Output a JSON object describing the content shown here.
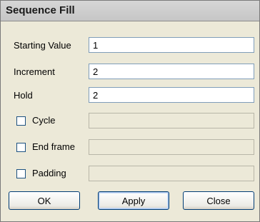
{
  "dialog": {
    "title": "Sequence Fill"
  },
  "fields": {
    "starting_value": {
      "label": "Starting Value",
      "value": "1"
    },
    "increment": {
      "label": "Increment",
      "value": "2"
    },
    "hold": {
      "label": "Hold",
      "value": "2"
    }
  },
  "options": {
    "cycle": {
      "label": "Cycle",
      "checked": false,
      "value": ""
    },
    "end_frame": {
      "label": "End frame",
      "checked": false,
      "value": ""
    },
    "padding": {
      "label": "Padding",
      "checked": false,
      "value": ""
    }
  },
  "buttons": {
    "ok": "OK",
    "apply": "Apply",
    "close": "Close"
  }
}
